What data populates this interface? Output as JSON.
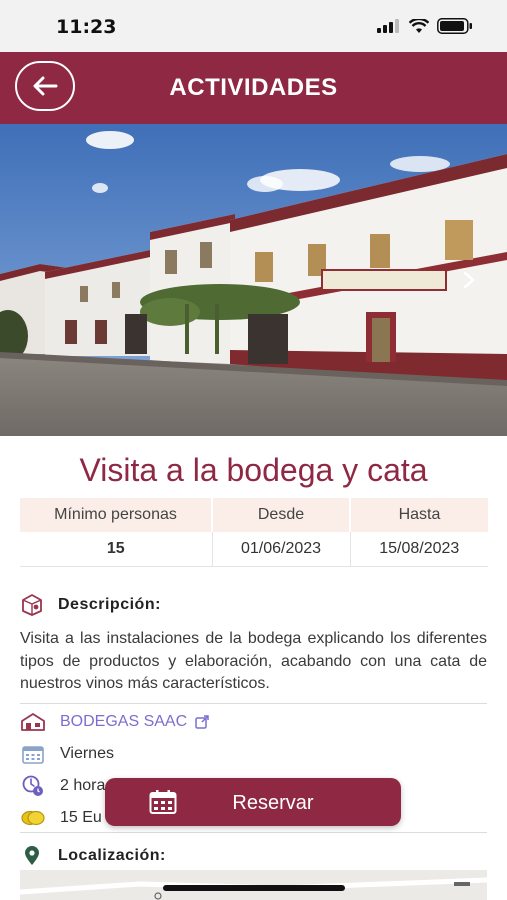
{
  "status_bar": {
    "time": "11:23"
  },
  "header": {
    "title": "ACTIVIDADES"
  },
  "activity": {
    "title": "Visita a la bodega y cata"
  },
  "info_table": {
    "headers": [
      "Mínimo personas",
      "Desde",
      "Hasta"
    ],
    "values": [
      "15",
      "01/06/2023",
      "15/08/2023"
    ]
  },
  "description": {
    "heading": "Descripción:",
    "text": "Visita a las instalaciones de la bodega explicando los diferentes tipos de productos y elaboración, acabando con una cata de nuestros vinos más característicos."
  },
  "details": {
    "winery": "BODEGAS SAAC",
    "day": "Viernes",
    "duration": "2 hora",
    "price": "15 Eu"
  },
  "reserve_button": {
    "label": "Reservar"
  },
  "location": {
    "heading": "Localización:"
  },
  "colors": {
    "brand": "#8e2843",
    "link": "#7a6fd0",
    "table_header": "#fbeee8"
  }
}
